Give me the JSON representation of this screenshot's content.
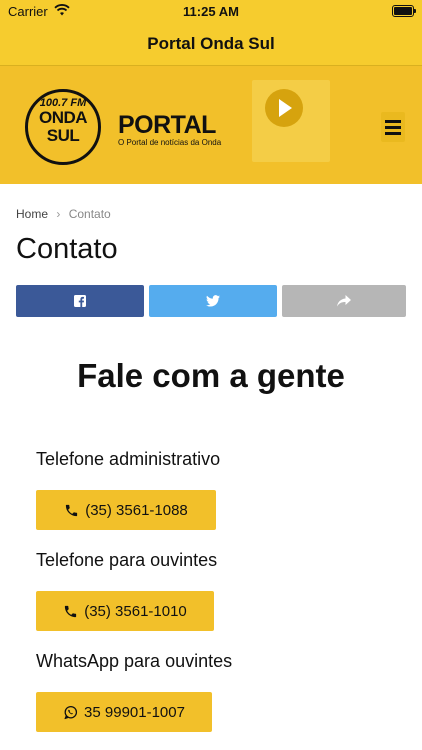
{
  "status_bar": {
    "carrier": "Carrier",
    "time": "11:25 AM"
  },
  "nav": {
    "title": "Portal Onda Sul"
  },
  "brand": {
    "radio_freq": "100.7 FM",
    "radio_name_line1": "ONDA",
    "radio_name_line2": "SUL",
    "portal_title": "PORTAL",
    "portal_tagline": "O Portal de notícias da Onda",
    "accent_color": "#f2c02a"
  },
  "breadcrumb": {
    "home": "Home",
    "separator": "›",
    "current": "Contato"
  },
  "page": {
    "title": "Contato"
  },
  "share": {
    "facebook_icon": "facebook-icon",
    "twitter_icon": "twitter-icon",
    "share_icon": "share-arrow-icon",
    "colors": {
      "facebook": "#3b5998",
      "twitter": "#55acee",
      "more": "#b6b6b6"
    }
  },
  "contact": {
    "heading": "Fale com a gente",
    "items": [
      {
        "label": "Telefone administrativo",
        "button": "(35) 3561-1088",
        "icon": "phone-icon"
      },
      {
        "label": "Telefone para ouvintes",
        "button": "(35) 3561-1010",
        "icon": "phone-icon"
      },
      {
        "label": "WhatsApp para ouvintes",
        "button": "35 99901-1007",
        "icon": "whatsapp-icon"
      }
    ]
  }
}
